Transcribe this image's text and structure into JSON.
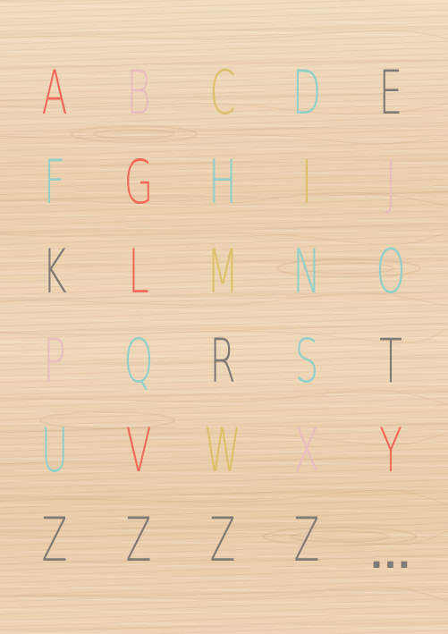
{
  "palette": {
    "coral": "#f06a5c",
    "pink": "#e9bcc0",
    "mustard": "#dcc06a",
    "teal": "#93cfca",
    "gray": "#7f7a76"
  },
  "letters": [
    {
      "char": "A",
      "color": "#f06a5c",
      "name": "letter-a"
    },
    {
      "char": "B",
      "color": "#e9bcc0",
      "name": "letter-b"
    },
    {
      "char": "C",
      "color": "#dcc06a",
      "name": "letter-c"
    },
    {
      "char": "D",
      "color": "#93cfca",
      "name": "letter-d"
    },
    {
      "char": "E",
      "color": "#7f7a76",
      "name": "letter-e"
    },
    {
      "char": "F",
      "color": "#93cfca",
      "name": "letter-f"
    },
    {
      "char": "G",
      "color": "#f06a5c",
      "name": "letter-g"
    },
    {
      "char": "H",
      "color": "#93cfca",
      "name": "letter-h"
    },
    {
      "char": "I",
      "color": "#dcc06a",
      "name": "letter-i"
    },
    {
      "char": "J",
      "color": "#e9bcc0",
      "name": "letter-j"
    },
    {
      "char": "K",
      "color": "#7f7a76",
      "name": "letter-k"
    },
    {
      "char": "L",
      "color": "#f06a5c",
      "name": "letter-l"
    },
    {
      "char": "M",
      "color": "#dcc06a",
      "name": "letter-m"
    },
    {
      "char": "N",
      "color": "#93cfca",
      "name": "letter-n"
    },
    {
      "char": "O",
      "color": "#93cfca",
      "name": "letter-o"
    },
    {
      "char": "P",
      "color": "#e9bcc0",
      "name": "letter-p"
    },
    {
      "char": "Q",
      "color": "#93cfca",
      "name": "letter-q"
    },
    {
      "char": "R",
      "color": "#7f7a76",
      "name": "letter-r"
    },
    {
      "char": "S",
      "color": "#93cfca",
      "name": "letter-s"
    },
    {
      "char": "T",
      "color": "#7f7a76",
      "name": "letter-t"
    },
    {
      "char": "U",
      "color": "#93cfca",
      "name": "letter-u"
    },
    {
      "char": "V",
      "color": "#f06a5c",
      "name": "letter-v"
    },
    {
      "char": "W",
      "color": "#dcc06a",
      "name": "letter-w"
    },
    {
      "char": "X",
      "color": "#e9bcc0",
      "name": "letter-x"
    },
    {
      "char": "Y",
      "color": "#f06a5c",
      "name": "letter-y"
    },
    {
      "char": "Z",
      "color": "#7f7a76",
      "name": "letter-z-1"
    },
    {
      "char": "Z",
      "color": "#7f7a76",
      "name": "letter-z-2"
    },
    {
      "char": "Z",
      "color": "#7f7a76",
      "name": "letter-z-3"
    },
    {
      "char": "Z",
      "color": "#7f7a76",
      "name": "letter-z-4"
    },
    {
      "char": "...",
      "color": "#7f7a76",
      "name": "ellipsis"
    }
  ]
}
